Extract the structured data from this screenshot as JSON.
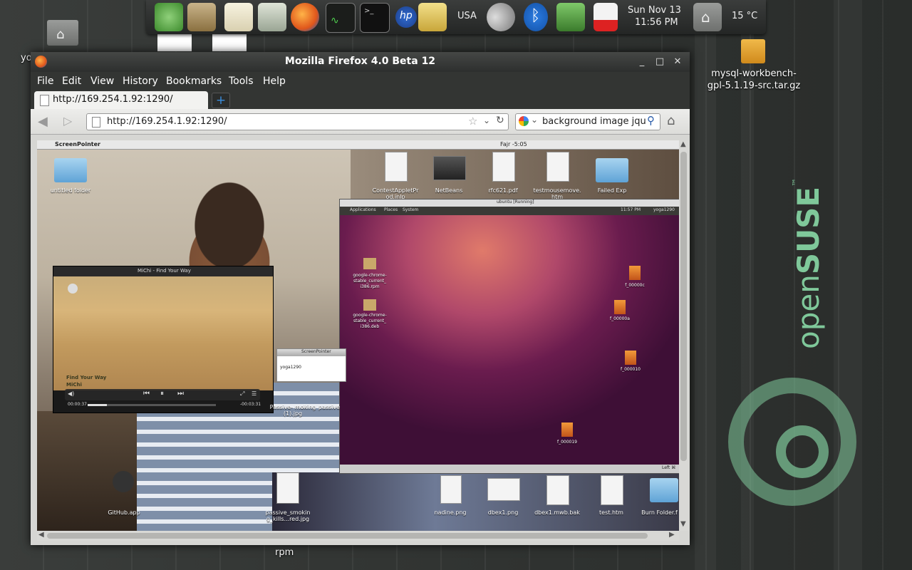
{
  "desktop": {
    "top_left_label": "yo",
    "right_file_label_line1": "mysql-workbench-",
    "right_file_label_line2": "gpl-5.1.19-src.tar.gz",
    "bottom_label": "rpm",
    "brand_text_1": "open",
    "brand_text_2": "SUSE",
    "brand_tm": "™"
  },
  "top_panel": {
    "keyboard_layout": "USA",
    "clock_date": "Sun Nov 13",
    "clock_time": "11:56 PM",
    "temperature": "15 °C"
  },
  "firefox": {
    "window_title": "Mozilla Firefox 4.0 Beta 12",
    "menu": [
      "File",
      "Edit",
      "View",
      "History",
      "Bookmarks",
      "Tools",
      "Help"
    ],
    "tab_label": "http://169.254.1.92:1290/",
    "url": "http://169.254.1.92:1290/",
    "search_text": "background image  jqu",
    "new_tab_symbol": "+"
  },
  "remote": {
    "mac_app": "ScreenPointer",
    "mac_time": "Fajr -5:05",
    "icons": {
      "untitled_folder": "untitled folder",
      "contest_applet": "ContestAppletPr od.jnlp",
      "netbeans": "NetBeans",
      "rfc_pdf": "rfc621.pdf",
      "testmousemove": "testmousemove. htm",
      "failed_exp": "Failed Exp",
      "github_app": "GitHub.app",
      "passive_smoking": "passive_smokin g_kills...red.jpg",
      "passive_1": "Passive- moking (1).jpg",
      "passive_2": "passive",
      "nadine": "nadine.png",
      "dbex1_png": "dbex1.png",
      "dbex1_bak": "dbex1.mwb.bak",
      "test_htm": "test.htm",
      "burn_folder": "Burn Folder.f"
    },
    "ubuntu": {
      "title": "ubuntu [Running]",
      "menu": [
        "Applications",
        "Places",
        "System"
      ],
      "time": "11:57 PM",
      "user": "yoga1290",
      "files": {
        "chrome_rpm": "google-chrome- stable_current_ i386.rpm",
        "chrome_deb": "google-chrome- stable_current_ i386.deb",
        "f1": "f_00000c",
        "f2": "f_00000a",
        "f3": "f_000010",
        "f4": "f_000019"
      },
      "status_right": "Left ⌘"
    },
    "player": {
      "title": "MiChi - Find Your Way",
      "subtitle_line1": "Find Your Way",
      "subtitle_line2": "MiChi",
      "elapsed": "00:00:37",
      "remaining": "-00:03:31",
      "progress": 0.15
    },
    "screenpointer": {
      "title": "ScreenPointer",
      "value": "yoga1290"
    }
  },
  "colors": {
    "panel": "#2d2f2e",
    "firefox_bg": "#333533",
    "opensuse_green": "#7fc89a"
  }
}
